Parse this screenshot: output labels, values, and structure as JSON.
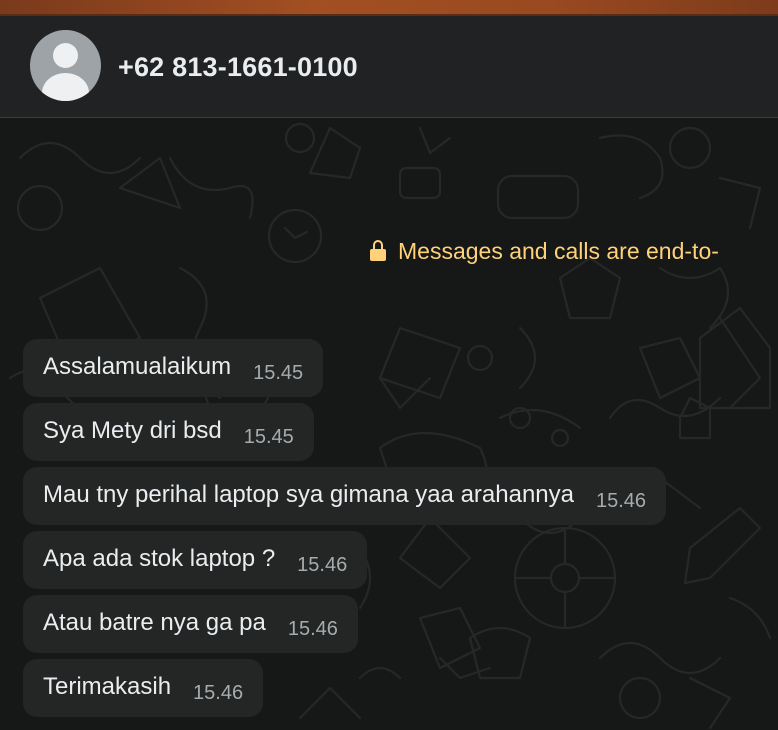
{
  "contact": {
    "name": "+62 813-1661-0100",
    "avatar_icon": "default-avatar-icon"
  },
  "encryption_notice": {
    "icon": "lock-icon",
    "text": "Messages and calls are end-to-"
  },
  "messages": [
    {
      "text": "Assalamualaikum",
      "time": "15.45"
    },
    {
      "text": "Sya Mety dri bsd",
      "time": "15.45"
    },
    {
      "text": "Mau tny perihal laptop sya gimana yaa arahannya",
      "time": "15.46"
    },
    {
      "text": "Apa ada stok laptop ?",
      "time": "15.46"
    },
    {
      "text": "Atau batre nya ga pa",
      "time": "15.46"
    },
    {
      "text": "Terimakasih",
      "time": "15.46"
    }
  ],
  "colors": {
    "header_bg": "#202223",
    "chat_bg": "#161717",
    "bubble_bg": "#242626",
    "notice_text": "#ffd279",
    "primary_text": "#e9edef",
    "time_text": "#a6abae"
  }
}
